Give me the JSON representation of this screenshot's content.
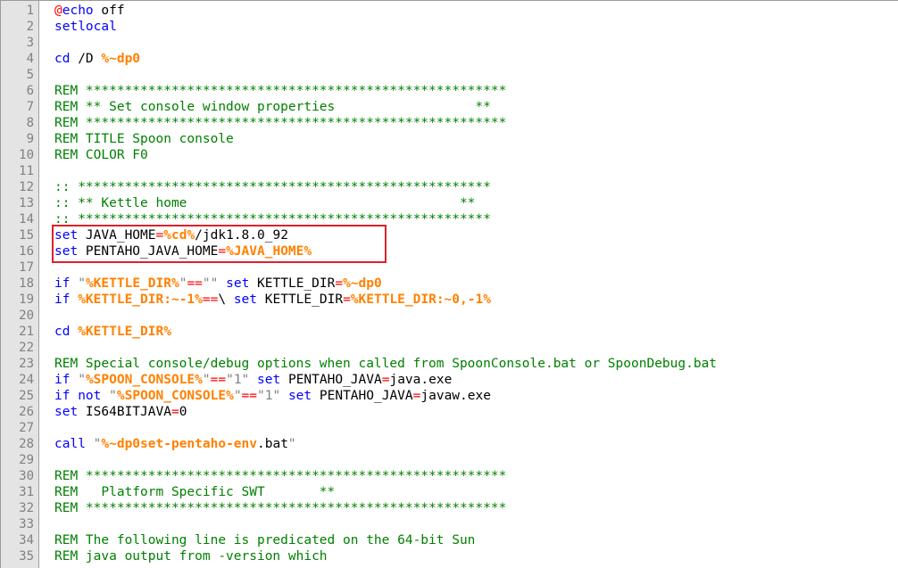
{
  "editor": {
    "colors": {
      "keyword": "#0000ff",
      "comment": "#008000",
      "operator": "#ff0000",
      "variable": "#ff8000",
      "string": "#808080",
      "text": "#000000",
      "highlight_box": "#e0202a"
    },
    "highlighted_lines": [
      15,
      16
    ],
    "lines": [
      {
        "n": "1",
        "tokens": [
          {
            "t": "at",
            "v": "@"
          },
          {
            "t": "kw",
            "v": "echo"
          },
          {
            "t": "text",
            "v": " off"
          }
        ]
      },
      {
        "n": "2",
        "tokens": [
          {
            "t": "kw",
            "v": "setlocal"
          }
        ]
      },
      {
        "n": "3",
        "tokens": []
      },
      {
        "n": "4",
        "tokens": [
          {
            "t": "kw",
            "v": "cd"
          },
          {
            "t": "text",
            "v": " /D "
          },
          {
            "t": "var",
            "v": "%~dp0"
          }
        ]
      },
      {
        "n": "5",
        "tokens": []
      },
      {
        "n": "6",
        "tokens": [
          {
            "t": "comment",
            "v": "REM ******************************************************"
          }
        ]
      },
      {
        "n": "7",
        "tokens": [
          {
            "t": "comment",
            "v": "REM ** Set console window properties                  **"
          }
        ]
      },
      {
        "n": "8",
        "tokens": [
          {
            "t": "comment",
            "v": "REM ******************************************************"
          }
        ]
      },
      {
        "n": "9",
        "tokens": [
          {
            "t": "comment",
            "v": "REM TITLE Spoon console"
          }
        ]
      },
      {
        "n": "10",
        "tokens": [
          {
            "t": "comment",
            "v": "REM COLOR F0"
          }
        ]
      },
      {
        "n": "11",
        "tokens": []
      },
      {
        "n": "12",
        "tokens": [
          {
            "t": "comment",
            "v": ":: *****************************************************"
          }
        ]
      },
      {
        "n": "13",
        "tokens": [
          {
            "t": "comment",
            "v": ":: ** Kettle home                                   **"
          }
        ]
      },
      {
        "n": "14",
        "tokens": [
          {
            "t": "comment",
            "v": ":: *****************************************************"
          }
        ]
      },
      {
        "n": "15",
        "tokens": [
          {
            "t": "kw",
            "v": "set"
          },
          {
            "t": "text",
            "v": " JAVA_HOME"
          },
          {
            "t": "op",
            "v": "="
          },
          {
            "t": "var",
            "v": "%cd%"
          },
          {
            "t": "text",
            "v": "/jdk1.8.0_92"
          }
        ]
      },
      {
        "n": "16",
        "tokens": [
          {
            "t": "kw",
            "v": "set"
          },
          {
            "t": "text",
            "v": " PENTAHO_JAVA_HOME"
          },
          {
            "t": "op",
            "v": "="
          },
          {
            "t": "var",
            "v": "%JAVA_HOME%"
          }
        ]
      },
      {
        "n": "17",
        "tokens": []
      },
      {
        "n": "18",
        "tokens": [
          {
            "t": "kw",
            "v": "if"
          },
          {
            "t": "text",
            "v": " "
          },
          {
            "t": "str",
            "v": "\""
          },
          {
            "t": "var",
            "v": "%KETTLE_DIR%"
          },
          {
            "t": "str",
            "v": "\""
          },
          {
            "t": "op",
            "v": "=="
          },
          {
            "t": "str",
            "v": "\"\""
          },
          {
            "t": "text",
            "v": " "
          },
          {
            "t": "kw",
            "v": "set"
          },
          {
            "t": "text",
            "v": " KETTLE_DIR"
          },
          {
            "t": "op",
            "v": "="
          },
          {
            "t": "var",
            "v": "%~dp0"
          }
        ]
      },
      {
        "n": "19",
        "tokens": [
          {
            "t": "kw",
            "v": "if"
          },
          {
            "t": "text",
            "v": " "
          },
          {
            "t": "var",
            "v": "%KETTLE_DIR:~-1%"
          },
          {
            "t": "op",
            "v": "=="
          },
          {
            "t": "text",
            "v": "\\ "
          },
          {
            "t": "kw",
            "v": "set"
          },
          {
            "t": "text",
            "v": " KETTLE_DIR"
          },
          {
            "t": "op",
            "v": "="
          },
          {
            "t": "var",
            "v": "%KETTLE_DIR:~0,-1%"
          }
        ]
      },
      {
        "n": "20",
        "tokens": []
      },
      {
        "n": "21",
        "tokens": [
          {
            "t": "kw",
            "v": "cd"
          },
          {
            "t": "text",
            "v": " "
          },
          {
            "t": "var",
            "v": "%KETTLE_DIR%"
          }
        ]
      },
      {
        "n": "22",
        "tokens": []
      },
      {
        "n": "23",
        "tokens": [
          {
            "t": "comment",
            "v": "REM Special console/debug options when called from SpoonConsole.bat or SpoonDebug.bat"
          }
        ]
      },
      {
        "n": "24",
        "tokens": [
          {
            "t": "kw",
            "v": "if"
          },
          {
            "t": "text",
            "v": " "
          },
          {
            "t": "str",
            "v": "\""
          },
          {
            "t": "var",
            "v": "%SPOON_CONSOLE%"
          },
          {
            "t": "str",
            "v": "\""
          },
          {
            "t": "op",
            "v": "=="
          },
          {
            "t": "str",
            "v": "\"1\""
          },
          {
            "t": "text",
            "v": " "
          },
          {
            "t": "kw",
            "v": "set"
          },
          {
            "t": "text",
            "v": " PENTAHO_JAVA"
          },
          {
            "t": "op",
            "v": "="
          },
          {
            "t": "text",
            "v": "java.exe"
          }
        ]
      },
      {
        "n": "25",
        "tokens": [
          {
            "t": "kw",
            "v": "if not"
          },
          {
            "t": "text",
            "v": " "
          },
          {
            "t": "str",
            "v": "\""
          },
          {
            "t": "var",
            "v": "%SPOON_CONSOLE%"
          },
          {
            "t": "str",
            "v": "\""
          },
          {
            "t": "op",
            "v": "=="
          },
          {
            "t": "str",
            "v": "\"1\""
          },
          {
            "t": "text",
            "v": " "
          },
          {
            "t": "kw",
            "v": "set"
          },
          {
            "t": "text",
            "v": " PENTAHO_JAVA"
          },
          {
            "t": "op",
            "v": "="
          },
          {
            "t": "text",
            "v": "javaw.exe"
          }
        ]
      },
      {
        "n": "26",
        "tokens": [
          {
            "t": "kw",
            "v": "set"
          },
          {
            "t": "text",
            "v": " IS64BITJAVA"
          },
          {
            "t": "op",
            "v": "="
          },
          {
            "t": "text",
            "v": "0"
          }
        ]
      },
      {
        "n": "27",
        "tokens": []
      },
      {
        "n": "28",
        "tokens": [
          {
            "t": "kw",
            "v": "call"
          },
          {
            "t": "text",
            "v": " "
          },
          {
            "t": "str",
            "v": "\""
          },
          {
            "t": "var",
            "v": "%~dp0set-pentaho-env"
          },
          {
            "t": "text",
            "v": ".bat"
          },
          {
            "t": "str",
            "v": "\""
          }
        ]
      },
      {
        "n": "29",
        "tokens": []
      },
      {
        "n": "30",
        "tokens": [
          {
            "t": "comment",
            "v": "REM ******************************************************"
          }
        ]
      },
      {
        "n": "31",
        "tokens": [
          {
            "t": "comment",
            "v": "REM   Platform Specific SWT       **"
          }
        ]
      },
      {
        "n": "32",
        "tokens": [
          {
            "t": "comment",
            "v": "REM ******************************************************"
          }
        ]
      },
      {
        "n": "33",
        "tokens": []
      },
      {
        "n": "34",
        "tokens": [
          {
            "t": "comment",
            "v": "REM The following line is predicated on the 64-bit Sun"
          }
        ]
      },
      {
        "n": "35",
        "tokens": [
          {
            "t": "comment",
            "v": "REM java output from -version which"
          }
        ]
      }
    ]
  }
}
